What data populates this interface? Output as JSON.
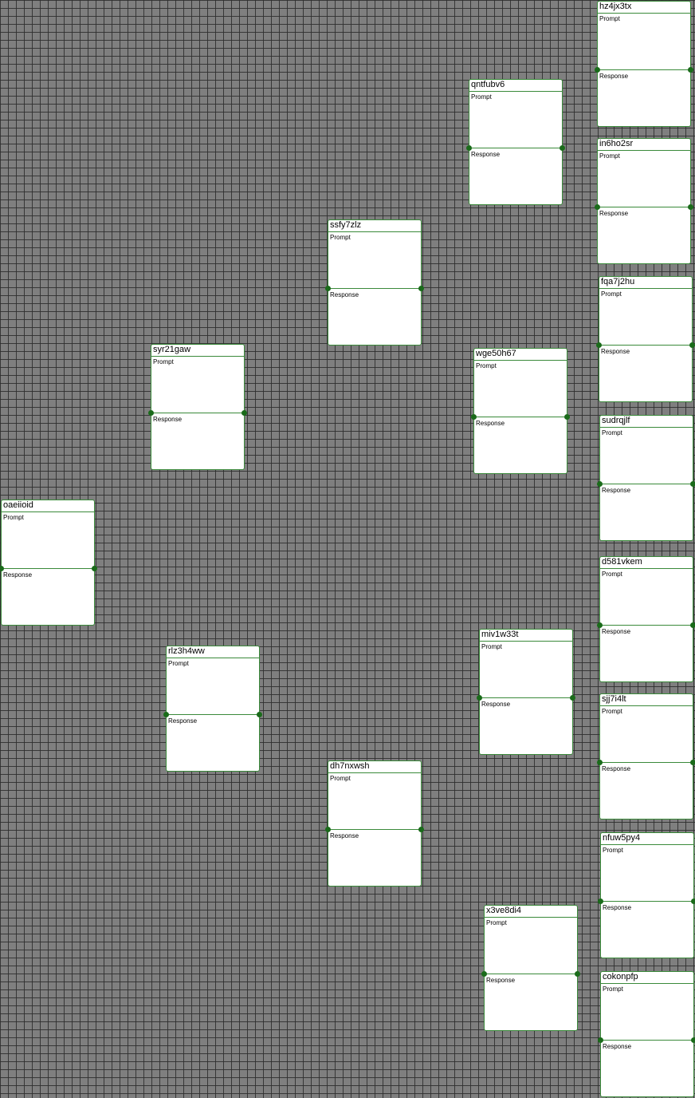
{
  "nodes": [
    {
      "id": "hz4jx3tx",
      "prompt_label": "Prompt",
      "response_label": "Response"
    },
    {
      "id": "qntfubv6",
      "prompt_label": "Prompt",
      "response_label": "Response"
    },
    {
      "id": "in6ho2sr",
      "prompt_label": "Prompt",
      "response_label": "Response"
    },
    {
      "id": "ssfy7zlz",
      "prompt_label": "Prompt",
      "response_label": "Response"
    },
    {
      "id": "fqa7j2hu",
      "prompt_label": "Prompt",
      "response_label": "Response"
    },
    {
      "id": "syr21gaw",
      "prompt_label": "Prompt",
      "response_label": "Response"
    },
    {
      "id": "wge50h67",
      "prompt_label": "Prompt",
      "response_label": "Response"
    },
    {
      "id": "sudrqjlf",
      "prompt_label": "Prompt",
      "response_label": "Response"
    },
    {
      "id": "oaeiioid",
      "prompt_label": "Prompt",
      "response_label": "Response"
    },
    {
      "id": "d581vkem",
      "prompt_label": "Prompt",
      "response_label": "Response"
    },
    {
      "id": "miv1w33t",
      "prompt_label": "Prompt",
      "response_label": "Response"
    },
    {
      "id": "rlz3h4ww",
      "prompt_label": "Prompt",
      "response_label": "Response"
    },
    {
      "id": "sjj7i4lt",
      "prompt_label": "Prompt",
      "response_label": "Response"
    },
    {
      "id": "dh7nxwsh",
      "prompt_label": "Prompt",
      "response_label": "Response"
    },
    {
      "id": "nfuw5py4",
      "prompt_label": "Prompt",
      "response_label": "Response"
    },
    {
      "id": "x3ve8di4",
      "prompt_label": "Prompt",
      "response_label": "Response"
    },
    {
      "id": "cokonpfp",
      "prompt_label": "Prompt",
      "response_label": "Response"
    }
  ]
}
